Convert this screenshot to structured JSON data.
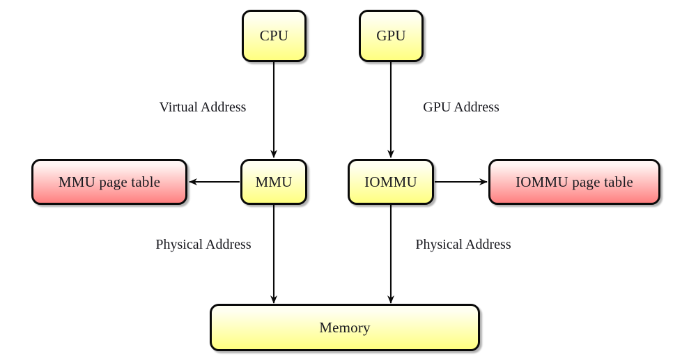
{
  "diagram": {
    "title": "CPU/GPU address translation diagram",
    "background_color": "#ffffff",
    "stroke_color": "#0a0a0a",
    "node_fill_yellow_top": "#fffff0",
    "node_fill_yellow_bottom": "#ffff80",
    "node_fill_red_top": "#fff4f2",
    "node_fill_red_bottom": "#ff8080",
    "text_color": "#16161c"
  },
  "nodes": {
    "cpu": {
      "label": "CPU",
      "style": "yellow"
    },
    "gpu": {
      "label": "GPU",
      "style": "yellow"
    },
    "mmu": {
      "label": "MMU",
      "style": "yellow"
    },
    "iommu": {
      "label": "IOMMU",
      "style": "yellow"
    },
    "mmu_page_table": {
      "label": "MMU page table",
      "style": "red"
    },
    "iommu_page_table": {
      "label": "IOMMU page table",
      "style": "red"
    },
    "memory": {
      "label": "Memory",
      "style": "yellow"
    }
  },
  "edge_labels": {
    "cpu_to_mmu": "Virtual Address",
    "gpu_to_iommu": "GPU Address",
    "mmu_to_memory": "Physical Address",
    "iommu_to_memory": "Physical Address"
  }
}
